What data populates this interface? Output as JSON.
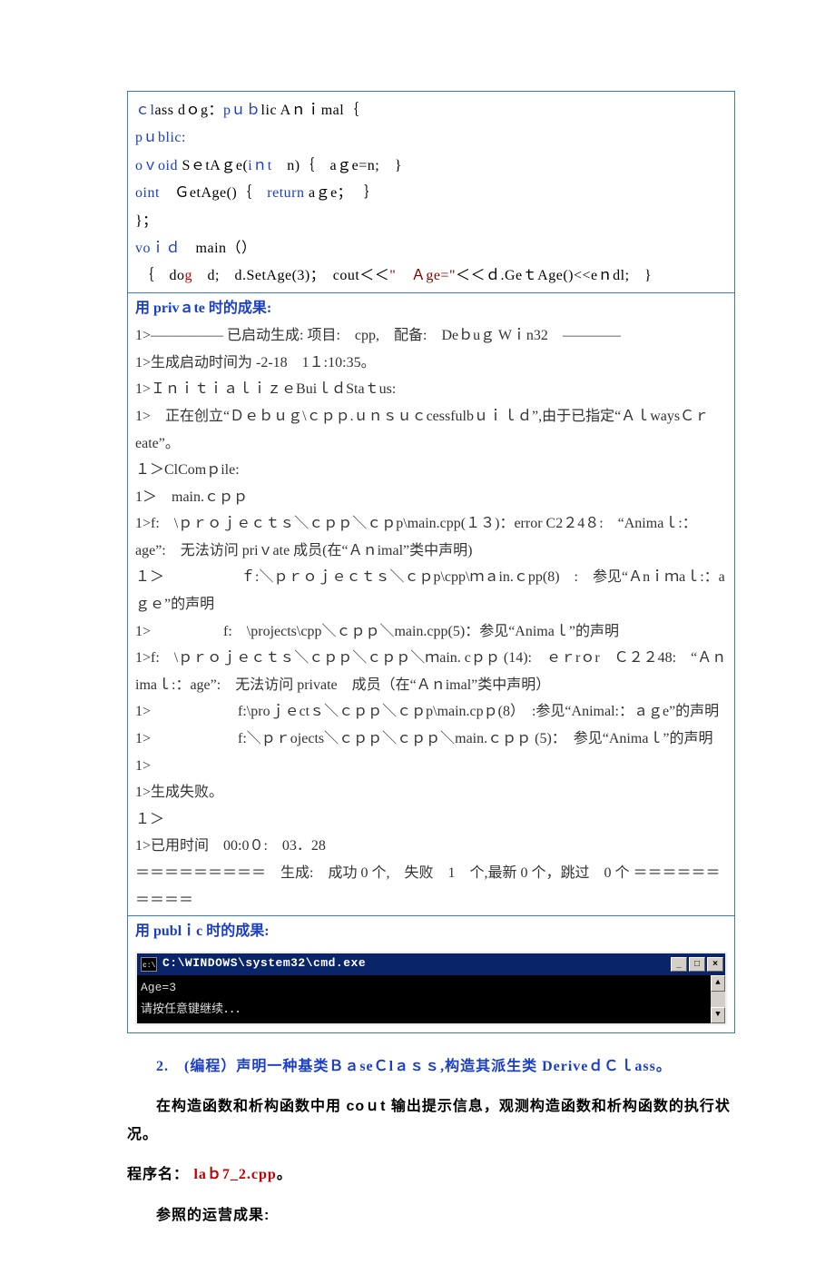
{
  "code": {
    "l1": {
      "a": "ｃl",
      "b": "ass",
      "c": " dｏg：",
      "d": "pｕｂ",
      "e": "lic",
      "f": " Aｎｉmal｛"
    },
    "l2": "pｕblic:",
    "l3": {
      "a": "ｖoid",
      "b": " SｅtAｇe(",
      "c": "iｎt",
      "d": "　n)｛　aｇe=n;　}"
    },
    "l4": {
      "a": "int",
      "b": "　ＧetAge()｛　",
      "c": "return",
      "d": " aｇe；　 ｝"
    },
    "l5": "}；",
    "l6": "",
    "l7": {
      "a": "voｉｄ",
      "b": "　main（）"
    },
    "l8": {
      "a": " ｛　do",
      "b": "g",
      "c": "　d;　d.SetAge(3)；　cout＜＜",
      "d": "\"",
      "e": "　Ａge=\"",
      "f": "＜＜ｄ.Geｔ",
      "g": "Age()<<eｎdl;　}"
    }
  },
  "sec1_hdr": "用 privａte 时的成果:",
  "out1": [
    "1>――――― 已启动生成: 项目:　cpp,　配备:　Deｂuｇ Wｉn32　――――",
    "1>生成启动时间为 -2-18　1１:10:35。",
    "1>ＩｎｉｔｉａｌｉｚｅBuiｌｄStaｔus:",
    "1>　正在创立“Ｄｅｂｕｇ\\ｃｐｐ.ｕｎｓｕｃcessfulbｕｉｌｄ”,由于已指定“ＡｌwaysＣｒeate”。",
    "１＞ClComｐile:",
    "1＞　main.ｃｐｐ",
    "1>f:　\\ｐｒｏｊｅｃｔｓ＼ｃｐｐ＼ｃｐp\\main.cpp(１３)：error C2２4８:　“Animaｌ:：age”:　无法访问 priｖate 成员(在“Ａｎimal”类中声明)",
    "１＞ 　　　　　ｆ:＼ｐｒｏｊｅｃｔｓ＼ｃｐp\\cpp\\ｍａin.ｃpp(8)　:　参见“Ａnｉｍaｌ:：aｇｅ”的声明",
    "1>　　　　　f:　\\projects\\cpp＼ｃｐｐ＼main.cpp(5)：参见“Animaｌ”的声明",
    "1>f:　\\ｐｒｏｊｅｃｔｓ＼ｃｐｐ＼ｃｐｐ＼ｍain. cｐｐ (14):　ｅｒrｏr　Ｃ２２48:　“Ａｎimaｌ:：age”:　无法访问 private　成员（在“Ａｎimal”类中声明）",
    "1>　　　　　　f:\\proｊｅctｓ＼ｃｐｐ＼ｃｐp\\main.cpｐ(8）　:参见“Animal:：ａｇe”的声明",
    "1>　　　　　　f:＼ｐｒojects＼ｃｐｐ＼ｃｐｐ＼main.ｃｐｐ (5)：　参见“Animaｌ”的声明",
    "1>",
    "1>生成失败。",
    "１＞",
    "1>已用时间　00:0０:　03．28",
    "＝＝＝＝＝＝＝＝＝　生成:　成功 0 个,　失败　1　个,最新 0 个，跳过　0 个 ＝＝＝＝＝＝＝＝＝＝"
  ],
  "sec2_hdr": "用 publｉc 时的成果:",
  "cmd": {
    "title": "C:\\WINDOWS\\system32\\cmd.exe",
    "body": "Age=3\n请按任意键继续．．．"
  },
  "q2_heading": "2.　(编程）声明一种基类ＢａseＣlａｓｓ,构造其派生类 DeriveｄＣｌass。",
  "q2_desc": "在构造函数和析构函数中用 coｕt 输出提示信息，观测构造函数和析构函数的执行状况。",
  "q2_prog_label": "程序名：",
  "q2_prog_file": "laｂ7_2.cpp",
  "q2_prog_period": "。",
  "q2_ref": "参照的运营成果:"
}
